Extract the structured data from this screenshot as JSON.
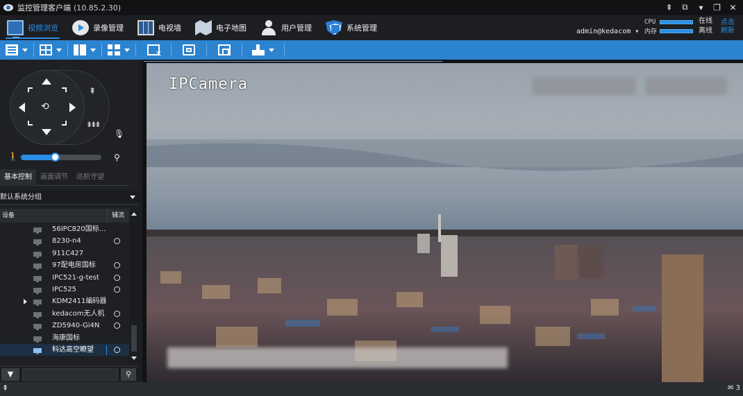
{
  "window": {
    "title": "监控管理客户端",
    "version": "(10.85.2.30)",
    "controls": [
      "expand-icon",
      "restore-icon",
      "dropdown-icon",
      "maximize-icon",
      "close-icon"
    ]
  },
  "nav": {
    "items": [
      {
        "label": "视频浏览",
        "icon": "monitor-icon",
        "active": true
      },
      {
        "label": "录像管理",
        "icon": "recording-icon",
        "active": false
      },
      {
        "label": "电视墙",
        "icon": "tv-wall-icon",
        "active": false
      },
      {
        "label": "电子地图",
        "icon": "map-icon",
        "active": false
      },
      {
        "label": "用户管理",
        "icon": "user-icon",
        "active": false
      },
      {
        "label": "系统管理",
        "icon": "shield-icon",
        "active": false
      }
    ],
    "account": "admin@kedacom",
    "cpu_label": "CPU",
    "mem_label": "内存",
    "online": "在线",
    "offline": "离线",
    "refresh": "点击刷新",
    "accent": "#2b8ee6"
  },
  "toolbar": {
    "buttons": [
      "film-layout-icon",
      "grid-layout-icon",
      "panel-layout-icon",
      "quad-layout-icon",
      "close-window-icon",
      "fullscreen-icon",
      "shrink-icon",
      "brush-icon"
    ]
  },
  "ptz": {
    "tabs": [
      "基本控制",
      "画面调节",
      "巡航守望"
    ],
    "active_tab": 0,
    "speed_level": 0.42
  },
  "devices": {
    "group": "默认系统分组",
    "col_device": "设备",
    "col_aux": "辅流",
    "items": [
      {
        "name": "56IPC820国标...",
        "rec": false,
        "expand": false,
        "selected": false
      },
      {
        "name": "8230-n4",
        "rec": true,
        "expand": false,
        "selected": false
      },
      {
        "name": "911C427",
        "rec": false,
        "expand": false,
        "selected": false
      },
      {
        "name": "97配电房国标",
        "rec": true,
        "expand": false,
        "selected": false
      },
      {
        "name": "IPC521-g-test",
        "rec": true,
        "expand": false,
        "selected": false
      },
      {
        "name": "IPC525",
        "rec": true,
        "expand": false,
        "selected": false
      },
      {
        "name": "KDM2411编码器",
        "rec": false,
        "expand": true,
        "selected": false
      },
      {
        "name": "kedacom无人机",
        "rec": true,
        "expand": false,
        "selected": false
      },
      {
        "name": "ZD5940-Gi4N",
        "rec": true,
        "expand": false,
        "selected": false
      },
      {
        "name": "海康国标",
        "rec": false,
        "expand": false,
        "selected": false
      },
      {
        "name": "科达高空瞭望",
        "rec": true,
        "expand": false,
        "selected": true
      }
    ]
  },
  "search": {
    "placeholder": ""
  },
  "video": {
    "osd_text": "IPCamera"
  },
  "status": {
    "message_count": "3"
  }
}
